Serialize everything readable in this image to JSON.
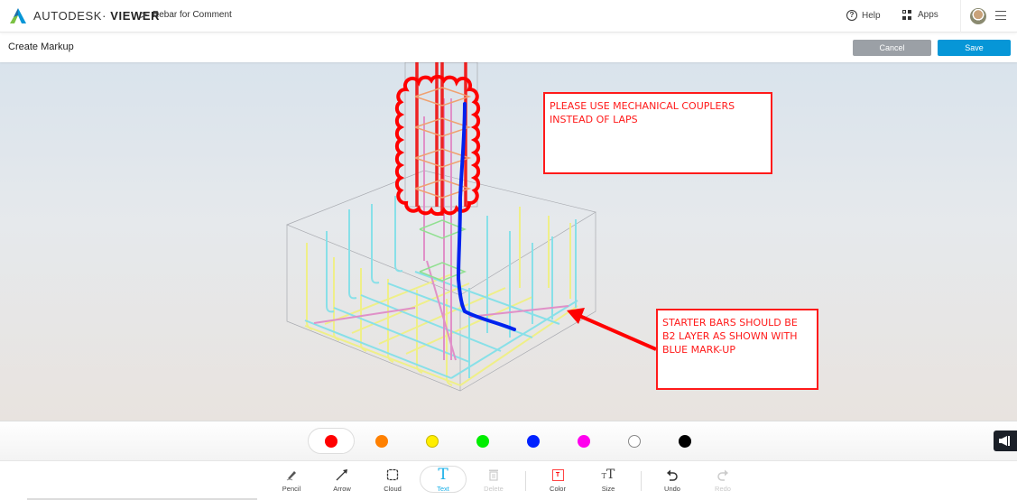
{
  "header": {
    "brand_light": "AUTODESK",
    "brand_bold": "VIEWER",
    "breadcrumb_separator": ">",
    "document_title": "Rebar for Comment",
    "help_label": "Help",
    "apps_label": "Apps",
    "logo_icon": "autodesk-logo",
    "avatar_icon": "user-avatar"
  },
  "subheader": {
    "title": "Create Markup",
    "cancel_label": "Cancel",
    "save_label": "Save",
    "save_color": "#0696d7",
    "cancel_color": "#9ba0a6"
  },
  "markups": {
    "notes": [
      {
        "text": "PLEASE USE MECHANICAL COUPLERS\nINSTEAD OF LAPS"
      },
      {
        "text": "STARTER BARS SHOULD BE\nB2 LAYER AS SHOWN WITH\nBLUE MARK-UP"
      }
    ],
    "markup_color": "#ff1a1a",
    "freehand_color": "#0022ee"
  },
  "palette": {
    "selected": "red",
    "colors": [
      {
        "name": "red",
        "hex": "#ff0000"
      },
      {
        "name": "orange",
        "hex": "#ff8000"
      },
      {
        "name": "yellow",
        "hex": "#ffee00"
      },
      {
        "name": "green",
        "hex": "#00ee00"
      },
      {
        "name": "blue",
        "hex": "#0022ff"
      },
      {
        "name": "magenta",
        "hex": "#ff00ee"
      },
      {
        "name": "white",
        "hex": "#ffffff"
      },
      {
        "name": "black",
        "hex": "#000000"
      }
    ]
  },
  "toolbar": {
    "tools": [
      {
        "id": "pencil",
        "label": "Pencil",
        "state": "normal"
      },
      {
        "id": "arrow",
        "label": "Arrow",
        "state": "normal"
      },
      {
        "id": "cloud",
        "label": "Cloud",
        "state": "normal"
      },
      {
        "id": "text",
        "label": "Text",
        "state": "active"
      },
      {
        "id": "delete",
        "label": "Delete",
        "state": "disabled"
      },
      {
        "id": "color",
        "label": "Color",
        "state": "normal"
      },
      {
        "id": "size",
        "label": "Size",
        "state": "normal"
      },
      {
        "id": "undo",
        "label": "Undo",
        "state": "normal"
      },
      {
        "id": "redo",
        "label": "Redo",
        "state": "disabled"
      }
    ],
    "active_color": "#1ab0e8"
  }
}
